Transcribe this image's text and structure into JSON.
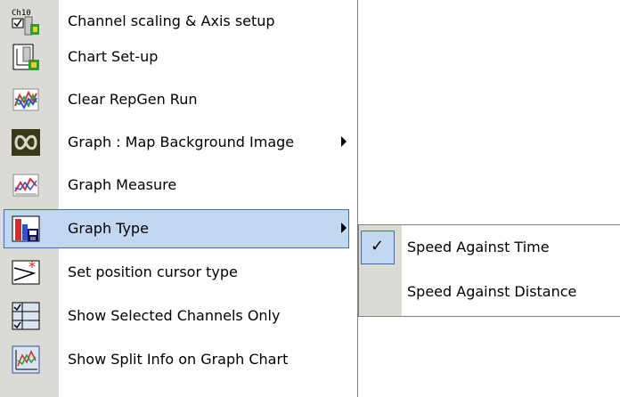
{
  "menu": {
    "items": [
      {
        "label": "Channel scaling & Axis setup",
        "icon": "channel-scaling-icon",
        "icon_text": "Ch10",
        "has_submenu": false
      },
      {
        "label": "Chart Set-up",
        "icon": "chart-setup-icon",
        "has_submenu": false
      },
      {
        "label": "Clear RepGen Run",
        "icon": "clear-repgen-icon",
        "has_submenu": false
      },
      {
        "label": "Graph : Map Background Image",
        "icon": "map-background-icon",
        "has_submenu": true
      },
      {
        "label": "Graph Measure",
        "icon": "graph-measure-icon",
        "has_submenu": false
      },
      {
        "label": "Graph Type",
        "icon": "graph-type-icon",
        "has_submenu": true,
        "highlighted": true
      },
      {
        "label": "Set position cursor type",
        "icon": "cursor-type-icon",
        "has_submenu": false
      },
      {
        "label": "Show Selected Channels Only",
        "icon": "selected-channels-icon",
        "has_submenu": false
      },
      {
        "label": "Show Split Info on Graph Chart",
        "icon": "split-info-icon",
        "has_submenu": false
      }
    ]
  },
  "submenu": {
    "items": [
      {
        "label": "Speed Against Time",
        "checked": true,
        "check_glyph": "✓"
      },
      {
        "label": "Speed Against Distance",
        "checked": false
      }
    ]
  },
  "colors": {
    "highlight_fill": "#c3d7f1",
    "highlight_border": "#3c6fb4",
    "gutter": "#dcdad5"
  }
}
